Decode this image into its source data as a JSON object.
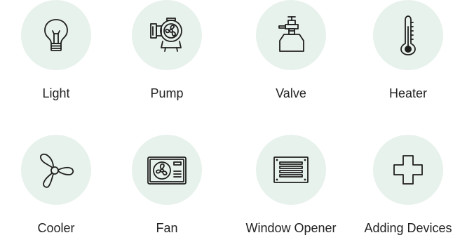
{
  "devices": [
    {
      "label": "Light",
      "icon": "light-bulb-icon"
    },
    {
      "label": "Pump",
      "icon": "pump-icon"
    },
    {
      "label": "Valve",
      "icon": "valve-icon"
    },
    {
      "label": "Heater",
      "icon": "thermometer-icon"
    },
    {
      "label": "Cooler",
      "icon": "propeller-icon"
    },
    {
      "label": "Fan",
      "icon": "air-conditioner-fan-icon"
    },
    {
      "label": "Window Opener",
      "icon": "window-vent-icon"
    },
    {
      "label": "Adding Devices",
      "icon": "plus-icon"
    }
  ],
  "colors": {
    "circle_bg": "#e8f2ec",
    "icon_stroke": "#1f1f1f",
    "label_text": "#222222"
  }
}
